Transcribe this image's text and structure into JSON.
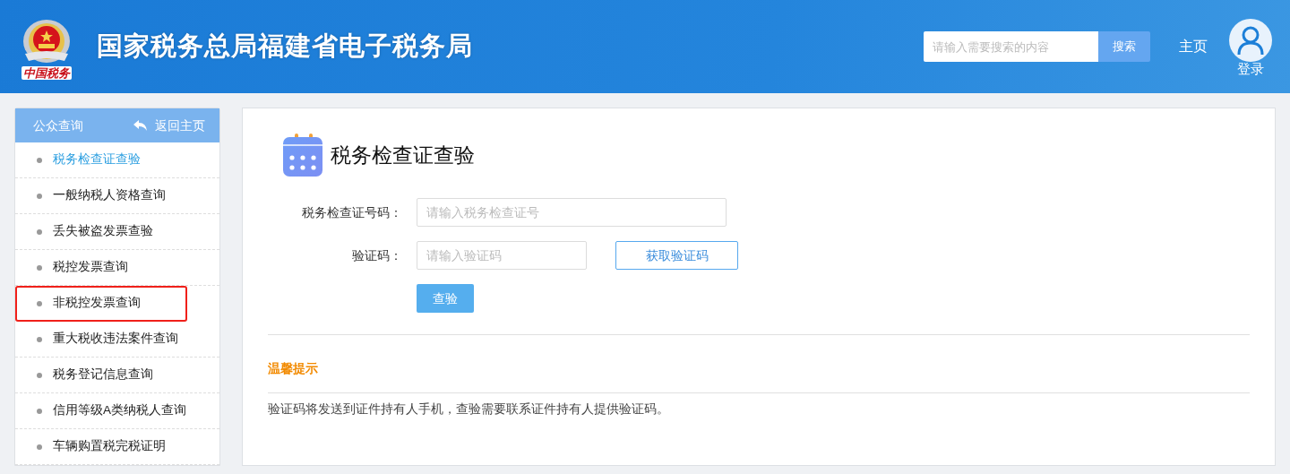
{
  "header": {
    "logo_caption": "中国税务",
    "title": "国家税务总局福建省电子税务局",
    "search": {
      "placeholder": "请输入需要搜索的内容",
      "button": "搜索"
    },
    "home_link": "主页",
    "login": "登录"
  },
  "sidebar": {
    "title": "公众查询",
    "back_link": "返回主页",
    "items": [
      {
        "label": "税务检查证查验",
        "selected": true,
        "highlighted": false
      },
      {
        "label": "一般纳税人资格查询",
        "selected": false,
        "highlighted": false
      },
      {
        "label": "丢失被盗发票查验",
        "selected": false,
        "highlighted": false
      },
      {
        "label": "税控发票查询",
        "selected": false,
        "highlighted": false
      },
      {
        "label": "非税控发票查询",
        "selected": false,
        "highlighted": true
      },
      {
        "label": "重大税收违法案件查询",
        "selected": false,
        "highlighted": false
      },
      {
        "label": "税务登记信息查询",
        "selected": false,
        "highlighted": false
      },
      {
        "label": "信用等级A类纳税人查询",
        "selected": false,
        "highlighted": false
      },
      {
        "label": "车辆购置税完税证明",
        "selected": false,
        "highlighted": false
      }
    ]
  },
  "main": {
    "title": "税务检查证查验",
    "form": {
      "fields": [
        {
          "label": "税务检查证号码：",
          "placeholder": "请输入税务检查证号",
          "kind": "wide"
        },
        {
          "label": "验证码：",
          "placeholder": "请输入验证码",
          "kind": "code",
          "button": "获取验证码"
        }
      ],
      "submit": "查验"
    },
    "tips": {
      "title": "温馨提示",
      "text": "验证码将发送到证件持有人手机，查验需要联系证件持有人提供验证码。"
    }
  }
}
